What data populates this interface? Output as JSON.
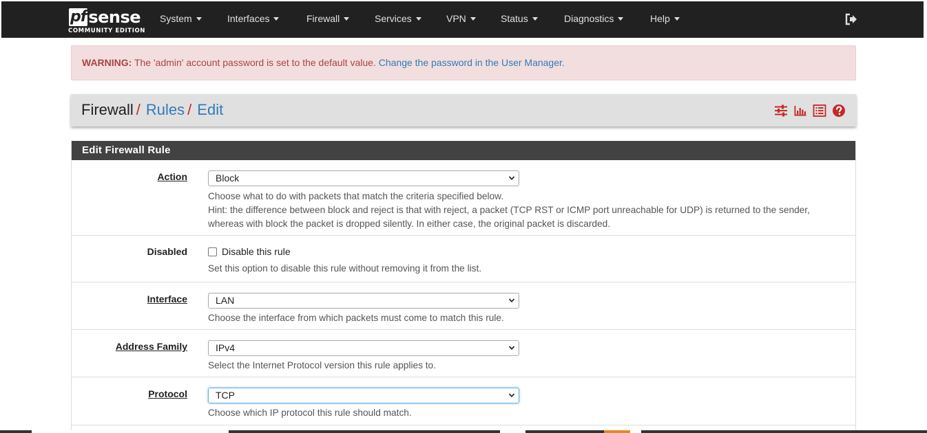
{
  "brand": {
    "logo_pf": "pf",
    "logo_sense": "sense",
    "edition": "COMMUNITY EDITION"
  },
  "nav": {
    "items": [
      {
        "label": "System"
      },
      {
        "label": "Interfaces"
      },
      {
        "label": "Firewall"
      },
      {
        "label": "Services"
      },
      {
        "label": "VPN"
      },
      {
        "label": "Status"
      },
      {
        "label": "Diagnostics"
      },
      {
        "label": "Help"
      }
    ],
    "logout_icon": "sign-out-icon"
  },
  "alert": {
    "prefix": "WARNING:",
    "message": " The 'admin' account password is set to the default value. ",
    "link": "Change the password in the User Manager."
  },
  "breadcrumb": {
    "items": [
      "Firewall",
      "Rules",
      "Edit"
    ],
    "separator": "/",
    "tool_icons": [
      "sliders-icon",
      "bar-chart-icon",
      "list-icon",
      "question-circle-icon"
    ]
  },
  "panel": {
    "title": "Edit Firewall Rule",
    "fields": {
      "action": {
        "label": "Action",
        "value": "Block",
        "help_1": "Choose what to do with packets that match the criteria specified below.",
        "help_2": "Hint: the difference between block and reject is that with reject, a packet (TCP RST or ICMP port unreachable for UDP) is returned to the sender,",
        "help_3": "whereas with block the packet is dropped silently. In either case, the original packet is discarded."
      },
      "disabled": {
        "label": "Disabled",
        "checkbox_label": "Disable this rule",
        "checked": false,
        "help": "Set this option to disable this rule without removing it from the list."
      },
      "interface": {
        "label": "Interface",
        "value": "LAN",
        "help": "Choose the interface from which packets must come to match this rule."
      },
      "address_family": {
        "label": "Address Family",
        "value": "IPv4",
        "help": "Select the Internet Protocol version this rule applies to."
      },
      "protocol": {
        "label": "Protocol",
        "value": "TCP",
        "help": "Choose which IP protocol this rule should match."
      }
    }
  },
  "colors": {
    "navbar": "#212121",
    "alert_bg": "#f2dede",
    "alert_text": "#a94442",
    "link": "#337ab7",
    "accent_red": "#c62828",
    "panel_heading": "#424242"
  }
}
